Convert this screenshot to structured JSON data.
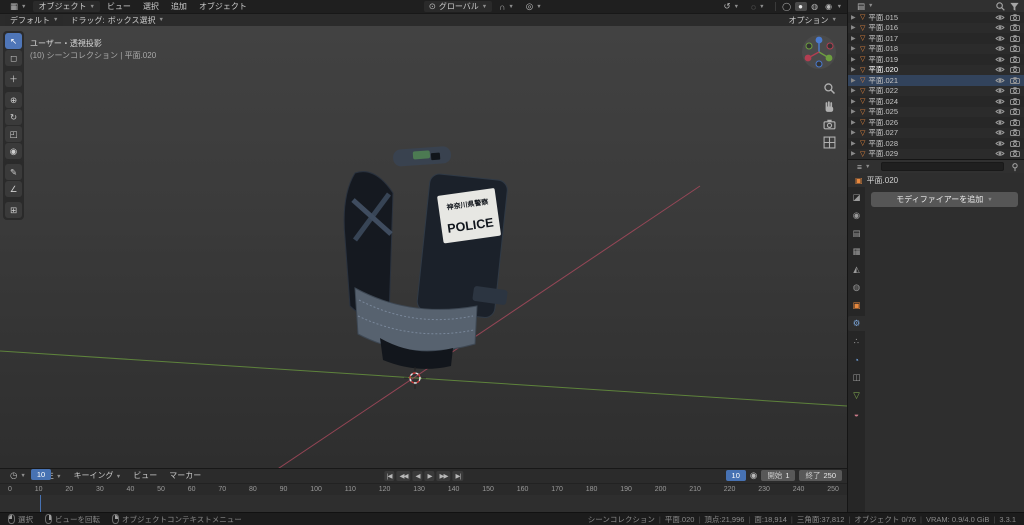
{
  "viewport_header": {
    "mode": "オブジェクト",
    "menu_view": "ビュー",
    "menu_select": "選択",
    "menu_add": "追加",
    "menu_object": "オブジェクト",
    "orientation": "グローバル",
    "icons": {
      "editor": "▦",
      "pivot": "⊙",
      "magnet": "∩",
      "proportional": "◎",
      "gizmo_toggle": "↺",
      "overlays": "◌"
    },
    "shading": [
      "◯",
      "●",
      "◍",
      "◉"
    ]
  },
  "tool_settings": {
    "mode_value": "デフォルト",
    "drag_label": "ドラッグ:",
    "drag_value": "ボックス選択",
    "options": "オプション"
  },
  "tools": [
    {
      "dn": "tool-tweak-select",
      "glyph": "↖",
      "cls": "active"
    },
    {
      "dn": "tool-select-box",
      "glyph": "◻"
    },
    {
      "dn": "tool-3d-cursor",
      "glyph": "＋",
      "cls": "gap"
    },
    {
      "dn": "tool-move",
      "glyph": "⊕",
      "cls": "gap"
    },
    {
      "dn": "tool-rotate",
      "glyph": "↻"
    },
    {
      "dn": "tool-scale",
      "glyph": "◰"
    },
    {
      "dn": "tool-transform",
      "glyph": "◉"
    },
    {
      "dn": "tool-annotate",
      "glyph": "✎",
      "cls": "gap"
    },
    {
      "dn": "tool-measure",
      "glyph": "∠"
    },
    {
      "dn": "tool-add-primitive",
      "glyph": "⊞",
      "cls": "gap"
    }
  ],
  "viewport": {
    "overlay_line1": "ユーザー・透視投影",
    "overlay_line2": "(10) シーンコレクション | 平面.020",
    "patch_line1": "神奈川県警察",
    "patch_line2": "POLICE"
  },
  "outliner": {
    "items": [
      {
        "dn": "outliner-row-015",
        "label": "平面.015"
      },
      {
        "dn": "outliner-row-016",
        "label": "平面.016"
      },
      {
        "dn": "outliner-row-017",
        "label": "平面.017"
      },
      {
        "dn": "outliner-row-018",
        "label": "平面.018"
      },
      {
        "dn": "outliner-row-019",
        "label": "平面.019"
      },
      {
        "dn": "outliner-row-020",
        "label": "平面.020",
        "cls": "active"
      },
      {
        "dn": "outliner-row-021",
        "label": "平面.021",
        "cls": "selected"
      },
      {
        "dn": "outliner-row-022",
        "label": "平面.022"
      },
      {
        "dn": "outliner-row-024",
        "label": "平面.024"
      },
      {
        "dn": "outliner-row-025",
        "label": "平面.025"
      },
      {
        "dn": "outliner-row-026",
        "label": "平面.026"
      },
      {
        "dn": "outliner-row-027",
        "label": "平面.027"
      },
      {
        "dn": "outliner-row-028",
        "label": "平面.028"
      },
      {
        "dn": "outliner-row-029",
        "label": "平面.029"
      }
    ]
  },
  "properties": {
    "breadcrumb_object": "平面.020",
    "add_modifier_label": "モディファイアーを追加",
    "editor_icon": "≡",
    "tabs": [
      {
        "dn": "tab-tool",
        "glyph": "◪"
      },
      {
        "dn": "tab-render",
        "glyph": "◉"
      },
      {
        "dn": "tab-output",
        "glyph": "▤"
      },
      {
        "dn": "tab-view-layer",
        "glyph": "▦"
      },
      {
        "dn": "tab-scene",
        "glyph": "◭"
      },
      {
        "dn": "tab-world",
        "glyph": "◍"
      },
      {
        "dn": "tab-object",
        "glyph": "▣",
        "cls": "orange"
      },
      {
        "dn": "tab-modifiers",
        "glyph": "⚙",
        "cls": "active wrench"
      },
      {
        "dn": "tab-particles",
        "glyph": "∴"
      },
      {
        "dn": "tab-physics",
        "glyph": "◔",
        "cls": "blue"
      },
      {
        "dn": "tab-constraints",
        "glyph": "◫"
      },
      {
        "dn": "tab-object-data",
        "glyph": "▽",
        "cls": "green"
      },
      {
        "dn": "tab-material",
        "glyph": "◒",
        "cls": "pink"
      }
    ]
  },
  "timeline": {
    "editor_icon": "◷",
    "menus": {
      "playback": "再生",
      "keying": "キーイング",
      "view": "ビュー",
      "marker": "マーカー"
    },
    "transport": {
      "jump_start": "|◀",
      "prev_key": "◀◀",
      "play_back": "◀",
      "play": "▶",
      "next_key": "▶▶",
      "jump_end": "▶|"
    },
    "current_frame": "10",
    "start_label": "開始",
    "start_value": "1",
    "end_label": "終了",
    "end_value": "250",
    "ruler": [
      "0",
      "10",
      "20",
      "30",
      "40",
      "50",
      "60",
      "70",
      "80",
      "90",
      "100",
      "110",
      "120",
      "130",
      "140",
      "150",
      "160",
      "170",
      "180",
      "190",
      "200",
      "210",
      "220",
      "230",
      "240",
      "250"
    ]
  },
  "statusbar": {
    "hints": [
      {
        "label": "選択"
      },
      {
        "label": "ビューを回転"
      },
      {
        "label": "オブジェクトコンテキストメニュー"
      }
    ],
    "stats": [
      "シーンコレクション",
      "平面.020",
      "頂点:21,996",
      "面:18,914",
      "三角面:37,812",
      "オブジェクト 0/76",
      "VRAM: 0.9/4.0 GiB",
      "3.3.1"
    ]
  }
}
